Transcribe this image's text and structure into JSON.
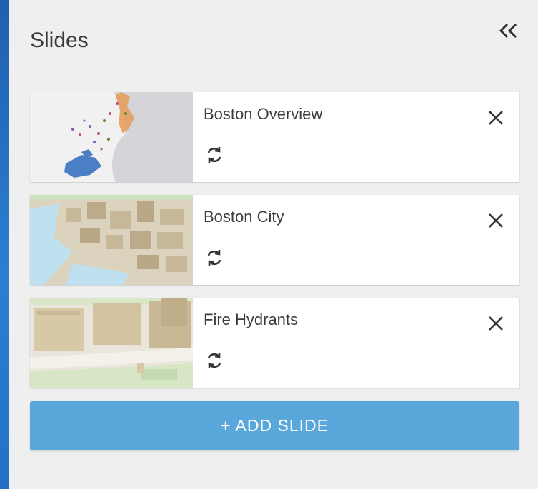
{
  "panel": {
    "title": "Slides",
    "collapse_icon": "double-chevron-left-icon"
  },
  "slides": [
    {
      "title": "Boston Overview",
      "thumbnail": "boston-overview-map-thumbnail"
    },
    {
      "title": "Boston City",
      "thumbnail": "boston-city-3d-buildings-thumbnail"
    },
    {
      "title": "Fire Hydrants",
      "thumbnail": "fire-hydrants-street-thumbnail"
    }
  ],
  "icons": {
    "update": "refresh-icon",
    "delete": "close-icon"
  },
  "add_button": {
    "label": "+ ADD SLIDE"
  },
  "colors": {
    "background": "#1f5fae",
    "panel": "#efefef",
    "card": "#ffffff",
    "accent": "#5aa7dc",
    "text": "#3c3c3c"
  }
}
